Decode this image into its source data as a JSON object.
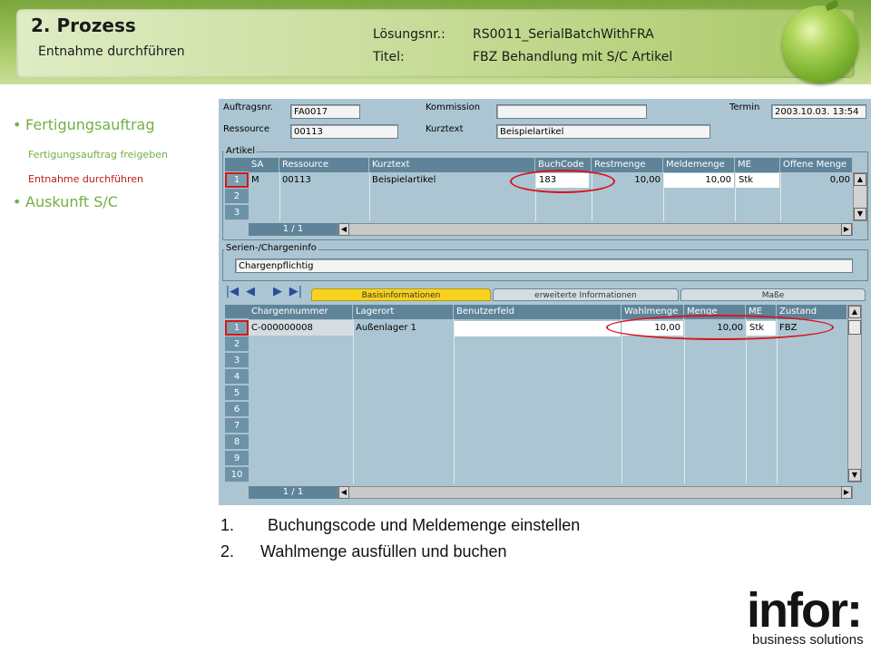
{
  "header": {
    "title": "2. Prozess",
    "subtitle": "Entnahme durchführen",
    "solution_label": "Lösungsnr.:",
    "solution_value": "RS0011_SerialBatchWithFRA",
    "title_label": "Titel:",
    "title_value": "FBZ Behandlung mit S/C Artikel"
  },
  "nav": {
    "items": [
      {
        "label": "Fertigungsauftrag",
        "color": "#72b043"
      },
      {
        "label": "Fertigungsauftrag freigeben",
        "color": "#72b043"
      },
      {
        "label": "Entnahme durchführen",
        "color": "#c21a1a"
      },
      {
        "label": "Auskunft S/C",
        "color": "#72b043"
      }
    ]
  },
  "form": {
    "auftragsnr_label": "Auftragsnr.",
    "auftragsnr_value": "FA0017",
    "kommission_label": "Kommission",
    "kommission_value": "",
    "termin_label": "Termin",
    "termin_value": "2003.10.03. 13:54",
    "ressource_label": "Ressource",
    "ressource_value": "00113",
    "kurztext_label": "Kurztext",
    "kurztext_value": "Beispielartikel"
  },
  "artikel": {
    "group_title": "Artikel",
    "columns": [
      "SA",
      "Ressource",
      "Kurztext",
      "BuchCode",
      "Restmenge",
      "Meldemenge",
      "ME",
      "Offene Menge"
    ],
    "rows": [
      {
        "num": "1",
        "sa": "M",
        "ressource": "00113",
        "kurztext": "Beispielartikel",
        "buchcode": "183",
        "restmenge": "10,00",
        "meldemenge": "10,00",
        "me": "Stk",
        "offene": "0,00"
      },
      {
        "num": "2"
      },
      {
        "num": "3"
      }
    ],
    "pager": "1 / 1"
  },
  "serien": {
    "group_title": "Serien-/Chargeninfo",
    "value": "Chargenpflichtig"
  },
  "tabs": [
    "Basisinformationen",
    "erweiterte Informationen",
    "Maße"
  ],
  "nav_buttons": [
    "|◀",
    "◀",
    "▶",
    "▶|"
  ],
  "charge": {
    "columns": [
      "Chargennummer",
      "Lagerort",
      "Benutzerfeld",
      "Wahlmenge",
      "Menge",
      "ME",
      "Zustand"
    ],
    "rows": [
      {
        "num": "1",
        "chargennummer": "C-000000008",
        "lagerort": "Außenlager 1",
        "benutzerfeld": "",
        "wahlmenge": "10,00",
        "menge": "10,00",
        "me": "Stk",
        "zustand": "FBZ"
      },
      {
        "num": "2"
      },
      {
        "num": "3"
      },
      {
        "num": "4"
      },
      {
        "num": "5"
      },
      {
        "num": "6"
      },
      {
        "num": "7"
      },
      {
        "num": "8"
      },
      {
        "num": "9"
      },
      {
        "num": "10"
      }
    ],
    "pager": "1 / 1"
  },
  "steps": [
    {
      "num": "1.",
      "text": "Buchungscode und Meldemenge einstellen"
    },
    {
      "num": "2.",
      "text": "Wahlmenge ausfüllen und buchen"
    }
  ],
  "logo": {
    "brand": "infor:",
    "tagline": "business solutions"
  },
  "colors": {
    "accent_green": "#72b043",
    "active_red": "#c21a1a",
    "highlight_tab": "#f8d21c",
    "annotation_red": "#d9141d"
  }
}
